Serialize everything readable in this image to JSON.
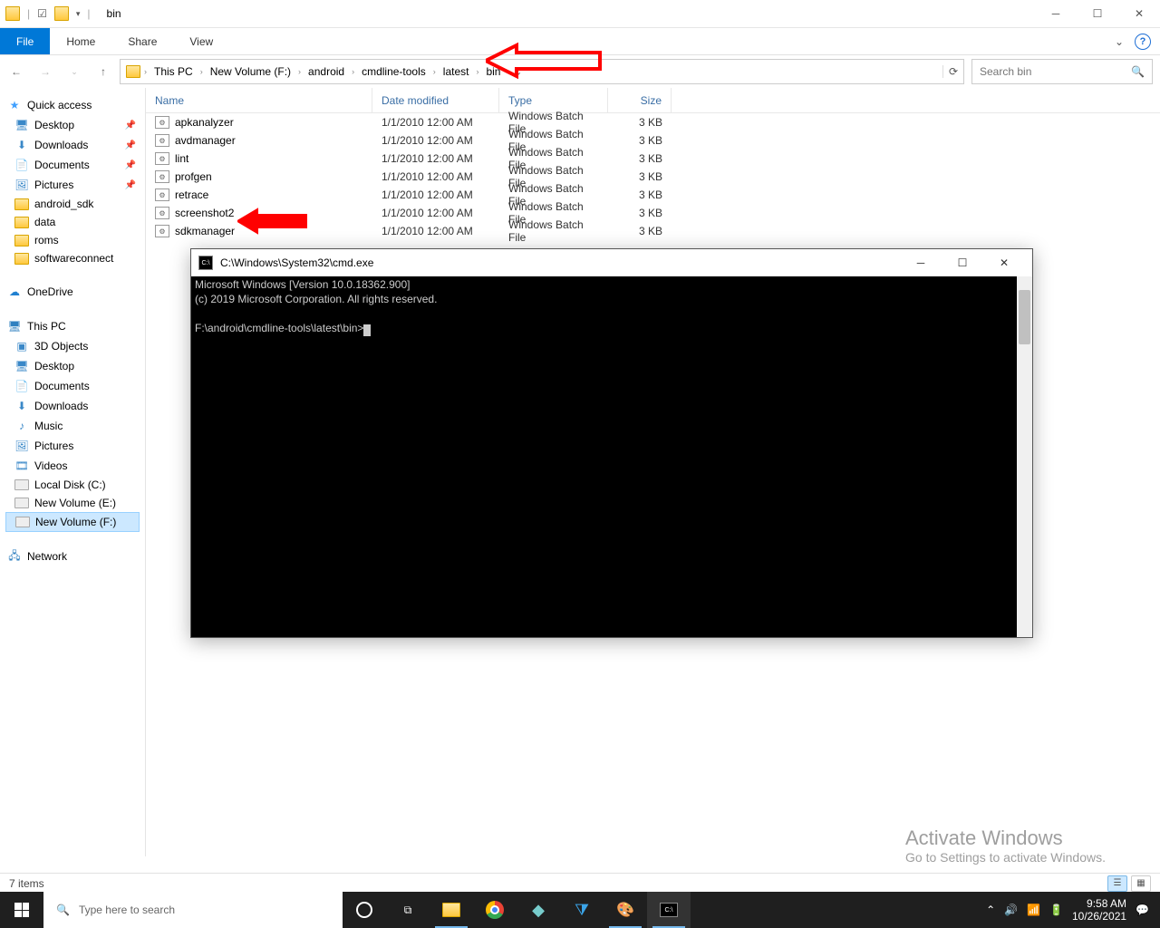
{
  "titlebar": {
    "title": "bin"
  },
  "ribbon": {
    "file": "File",
    "home": "Home",
    "share": "Share",
    "view": "View"
  },
  "breadcrumb": [
    "This PC",
    "New Volume (F:)",
    "android",
    "cmdline-tools",
    "latest",
    "bin"
  ],
  "search": {
    "placeholder": "Search bin"
  },
  "sidebar": {
    "quick_access": {
      "label": "Quick access"
    },
    "quick_items": [
      {
        "label": "Desktop",
        "pinned": true
      },
      {
        "label": "Downloads",
        "pinned": true
      },
      {
        "label": "Documents",
        "pinned": true
      },
      {
        "label": "Pictures",
        "pinned": true
      },
      {
        "label": "android_sdk"
      },
      {
        "label": "data"
      },
      {
        "label": "roms"
      },
      {
        "label": "softwareconnect"
      }
    ],
    "onedrive": "OneDrive",
    "thispc": {
      "label": "This PC"
    },
    "pc_items": [
      "3D Objects",
      "Desktop",
      "Documents",
      "Downloads",
      "Music",
      "Pictures",
      "Videos",
      "Local Disk (C:)",
      "New Volume (E:)",
      "New Volume (F:)"
    ],
    "network": "Network"
  },
  "columns": {
    "name": "Name",
    "date": "Date modified",
    "type": "Type",
    "size": "Size"
  },
  "files": [
    {
      "name": "apkanalyzer",
      "date": "1/1/2010 12:00 AM",
      "type": "Windows Batch File",
      "size": "3 KB"
    },
    {
      "name": "avdmanager",
      "date": "1/1/2010 12:00 AM",
      "type": "Windows Batch File",
      "size": "3 KB"
    },
    {
      "name": "lint",
      "date": "1/1/2010 12:00 AM",
      "type": "Windows Batch File",
      "size": "3 KB"
    },
    {
      "name": "profgen",
      "date": "1/1/2010 12:00 AM",
      "type": "Windows Batch File",
      "size": "3 KB"
    },
    {
      "name": "retrace",
      "date": "1/1/2010 12:00 AM",
      "type": "Windows Batch File",
      "size": "3 KB"
    },
    {
      "name": "screenshot2",
      "date": "1/1/2010 12:00 AM",
      "type": "Windows Batch File",
      "size": "3 KB"
    },
    {
      "name": "sdkmanager",
      "date": "1/1/2010 12:00 AM",
      "type": "Windows Batch File",
      "size": "3 KB"
    }
  ],
  "statusbar": {
    "count": "7 items"
  },
  "cmd": {
    "title": "C:\\Windows\\System32\\cmd.exe",
    "line1": "Microsoft Windows [Version 10.0.18362.900]",
    "line2": "(c) 2019 Microsoft Corporation. All rights reserved.",
    "prompt": "F:\\android\\cmdline-tools\\latest\\bin>"
  },
  "watermark": {
    "title": "Activate Windows",
    "sub": "Go to Settings to activate Windows."
  },
  "taskbar": {
    "search_placeholder": "Type here to search",
    "time": "9:58 AM",
    "date": "10/26/2021"
  }
}
